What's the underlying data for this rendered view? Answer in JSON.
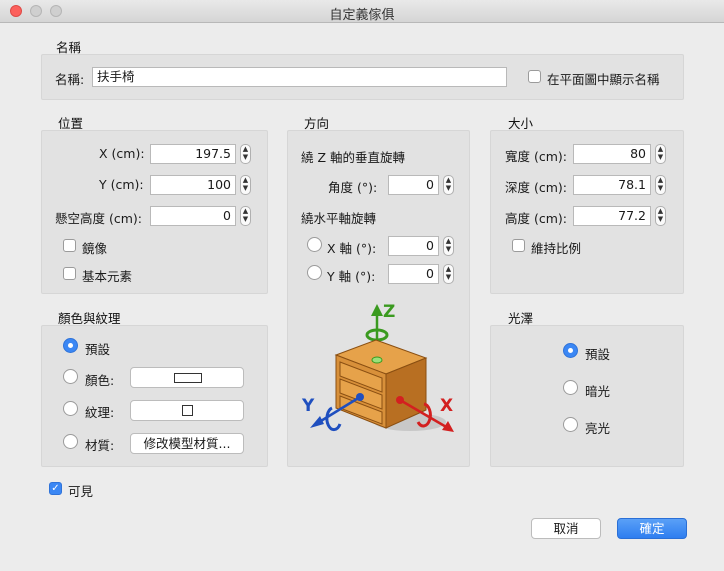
{
  "window": {
    "title": "自定義傢俱"
  },
  "name_section": {
    "header": "名稱",
    "label": "名稱:",
    "value": "扶手椅",
    "show_name_label": "在平面圖中顯示名稱",
    "show_name_checked": false
  },
  "position": {
    "header": "位置",
    "x_label": "X (cm):",
    "x_value": "197.5",
    "y_label": "Y (cm):",
    "y_value": "100",
    "elevation_label": "懸空高度 (cm):",
    "elevation_value": "0",
    "mirror_label": "鏡像",
    "basic_element_label": "基本元素"
  },
  "orientation": {
    "header": "方向",
    "vertical_rotation_title": "繞 Z 軸的垂直旋轉",
    "angle_label": "角度 (°):",
    "angle_value": "0",
    "horizontal_rotation_title": "繞水平軸旋轉",
    "x_axis_label": "X 軸 (°):",
    "x_axis_value": "0",
    "y_axis_label": "Y 軸 (°):",
    "y_axis_value": "0",
    "axis_z": "Z",
    "axis_x": "X",
    "axis_y": "Y"
  },
  "size": {
    "header": "大小",
    "width_label": "寬度 (cm):",
    "width_value": "80",
    "depth_label": "深度 (cm):",
    "depth_value": "78.1",
    "height_label": "高度 (cm):",
    "height_value": "77.2",
    "keep_ratio_label": "維持比例"
  },
  "color_texture": {
    "header": "顏色與紋理",
    "default_label": "預設",
    "color_label": "顏色:",
    "texture_label": "紋理:",
    "material_label": "材質:",
    "modify_material_button": "修改模型材質..."
  },
  "shininess": {
    "header": "光澤",
    "default_label": "預設",
    "matt_label": "暗光",
    "shiny_label": "亮光"
  },
  "visible": {
    "label": "可見",
    "checked": true
  },
  "buttons": {
    "cancel": "取消",
    "ok": "確定"
  },
  "icon_names": {
    "close": "close-window-icon",
    "furniture": "nightstand-3d-icon",
    "rotation_arrow": "rotation-arrow-icon"
  },
  "colors": {
    "accent": "#3b87f4",
    "axis_x": "#d32020",
    "axis_y": "#1f4fbf",
    "axis_z": "#3a9a1f",
    "wood": "#d8903a"
  }
}
